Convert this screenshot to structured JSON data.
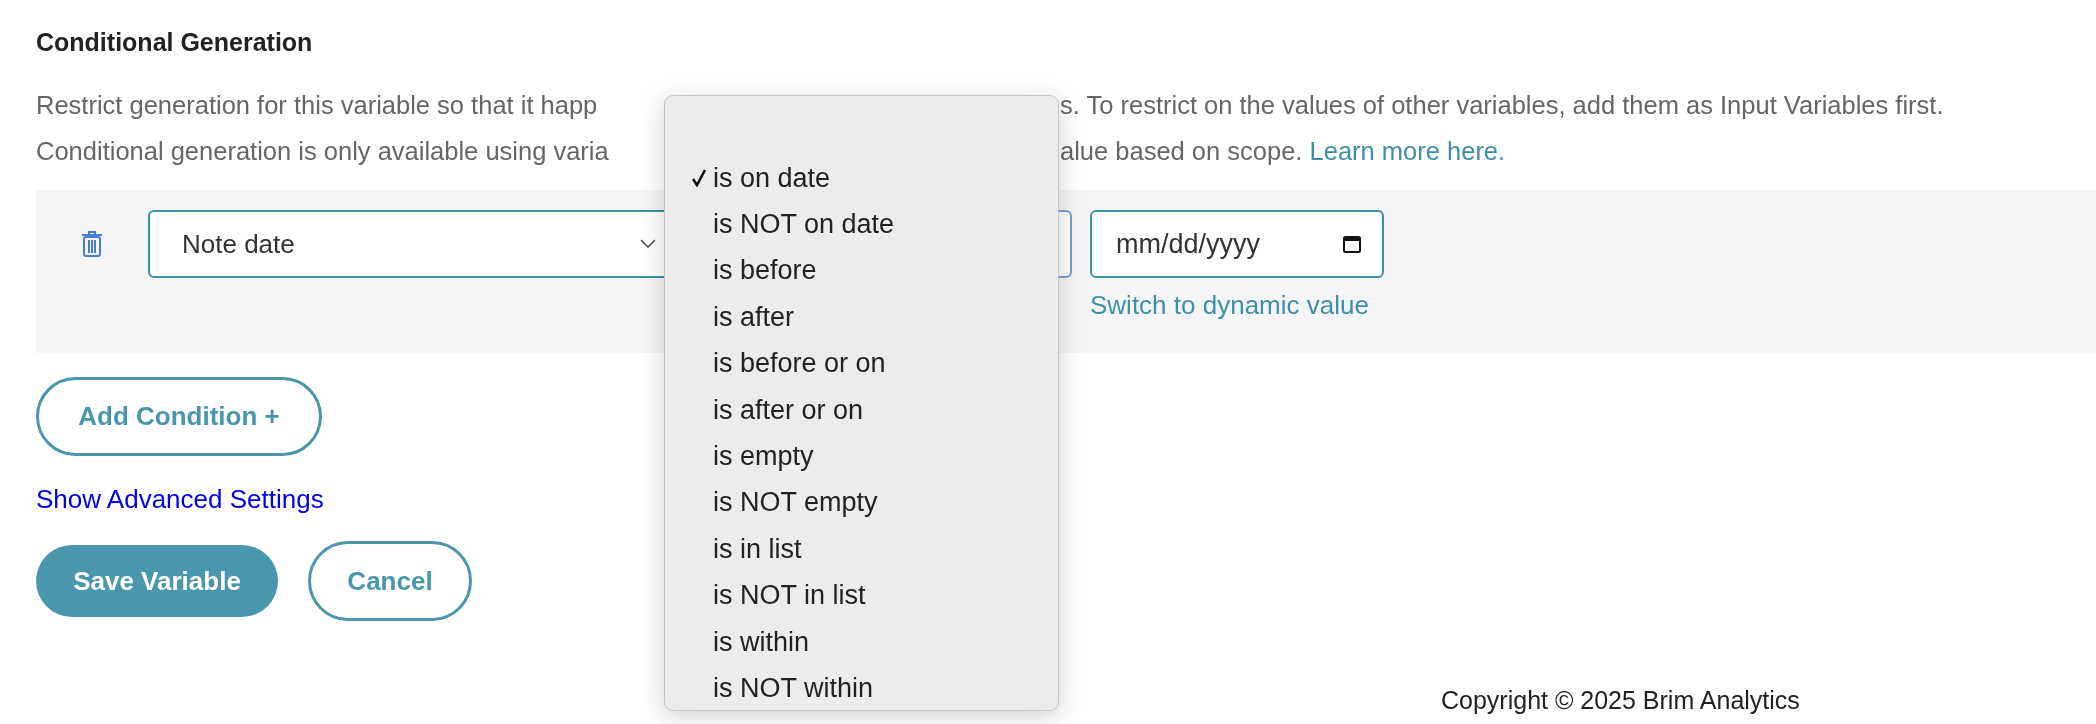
{
  "section": {
    "title": "Conditional Generation",
    "description_lines": [
      {
        "before_menu": "Restrict generation for this variable so that it happ",
        "after_menu": "s. To restrict on the values of other variables, add them as Input Variables first."
      },
      {
        "before_menu": "Conditional generation is only available using varia",
        "after_menu": "alue based on scope.",
        "link": "Learn more here."
      }
    ]
  },
  "condition": {
    "field": {
      "value": "Note date"
    },
    "date_input": {
      "placeholder": "mm/dd/yyyy"
    },
    "switch_link": "Switch to dynamic value"
  },
  "operator_menu": {
    "options": [
      {
        "label": "is on date",
        "selected": true
      },
      {
        "label": "is NOT on date",
        "selected": false
      },
      {
        "label": "is before",
        "selected": false
      },
      {
        "label": "is after",
        "selected": false
      },
      {
        "label": "is before or on",
        "selected": false
      },
      {
        "label": "is after or on",
        "selected": false
      },
      {
        "label": "is empty",
        "selected": false
      },
      {
        "label": "is NOT empty",
        "selected": false
      },
      {
        "label": "is in list",
        "selected": false
      },
      {
        "label": "is NOT in list",
        "selected": false
      },
      {
        "label": "is within",
        "selected": false
      },
      {
        "label": "is NOT within",
        "selected": false
      }
    ]
  },
  "add_condition": "Add Condition +",
  "advanced_link": "Show Advanced Settings",
  "actions": {
    "save": "Save Variable",
    "cancel": "Cancel"
  },
  "footer": {
    "copyright": "Copyright © 2025 Brim Analytics"
  }
}
